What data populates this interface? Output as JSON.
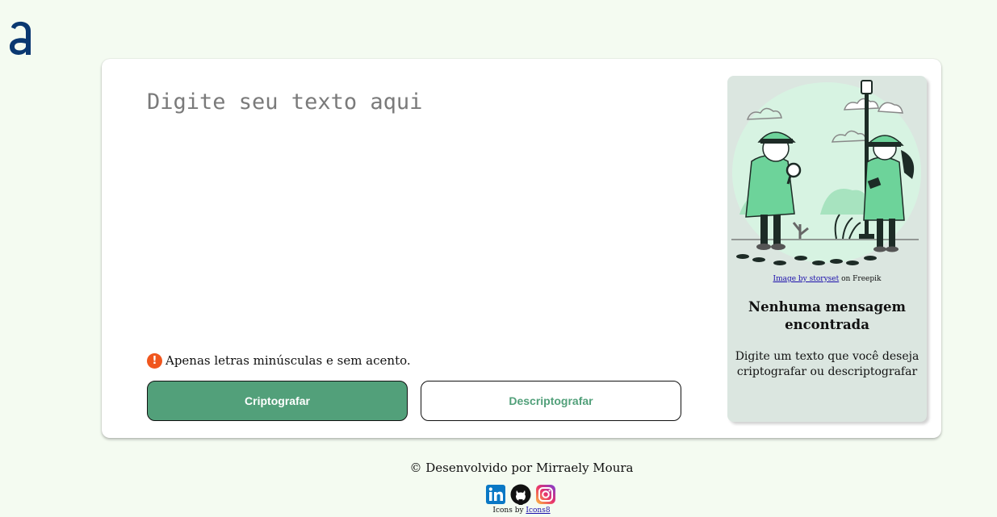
{
  "header": {
    "logo": "alura-logo-icon"
  },
  "editor": {
    "placeholder": "Digite seu texto aqui"
  },
  "hint": {
    "icon": "warning-icon",
    "text": "Apenas letras minúsculas e sem acento."
  },
  "buttons": {
    "encrypt": "Criptografar",
    "decrypt": "Descriptografar"
  },
  "aside": {
    "illustration": "detectives-illustration",
    "credit_link": "Image by storyset",
    "credit_suffix": " on Freepik",
    "title": "Nenhuma mensagem encontrada",
    "message": "Digite um texto que você deseja criptografar ou descriptografar"
  },
  "footer": {
    "text": "© Desenvolvido por Mirraely Moura",
    "icons_by": "Icons by ",
    "icons_link": "Icons8",
    "socials": [
      "linkedin-icon",
      "github-icon",
      "instagram-icon"
    ]
  },
  "colors": {
    "accent": "#52a07a",
    "background": "#f4fbf1",
    "warning": "#f0561d",
    "brand": "#0a3871"
  }
}
